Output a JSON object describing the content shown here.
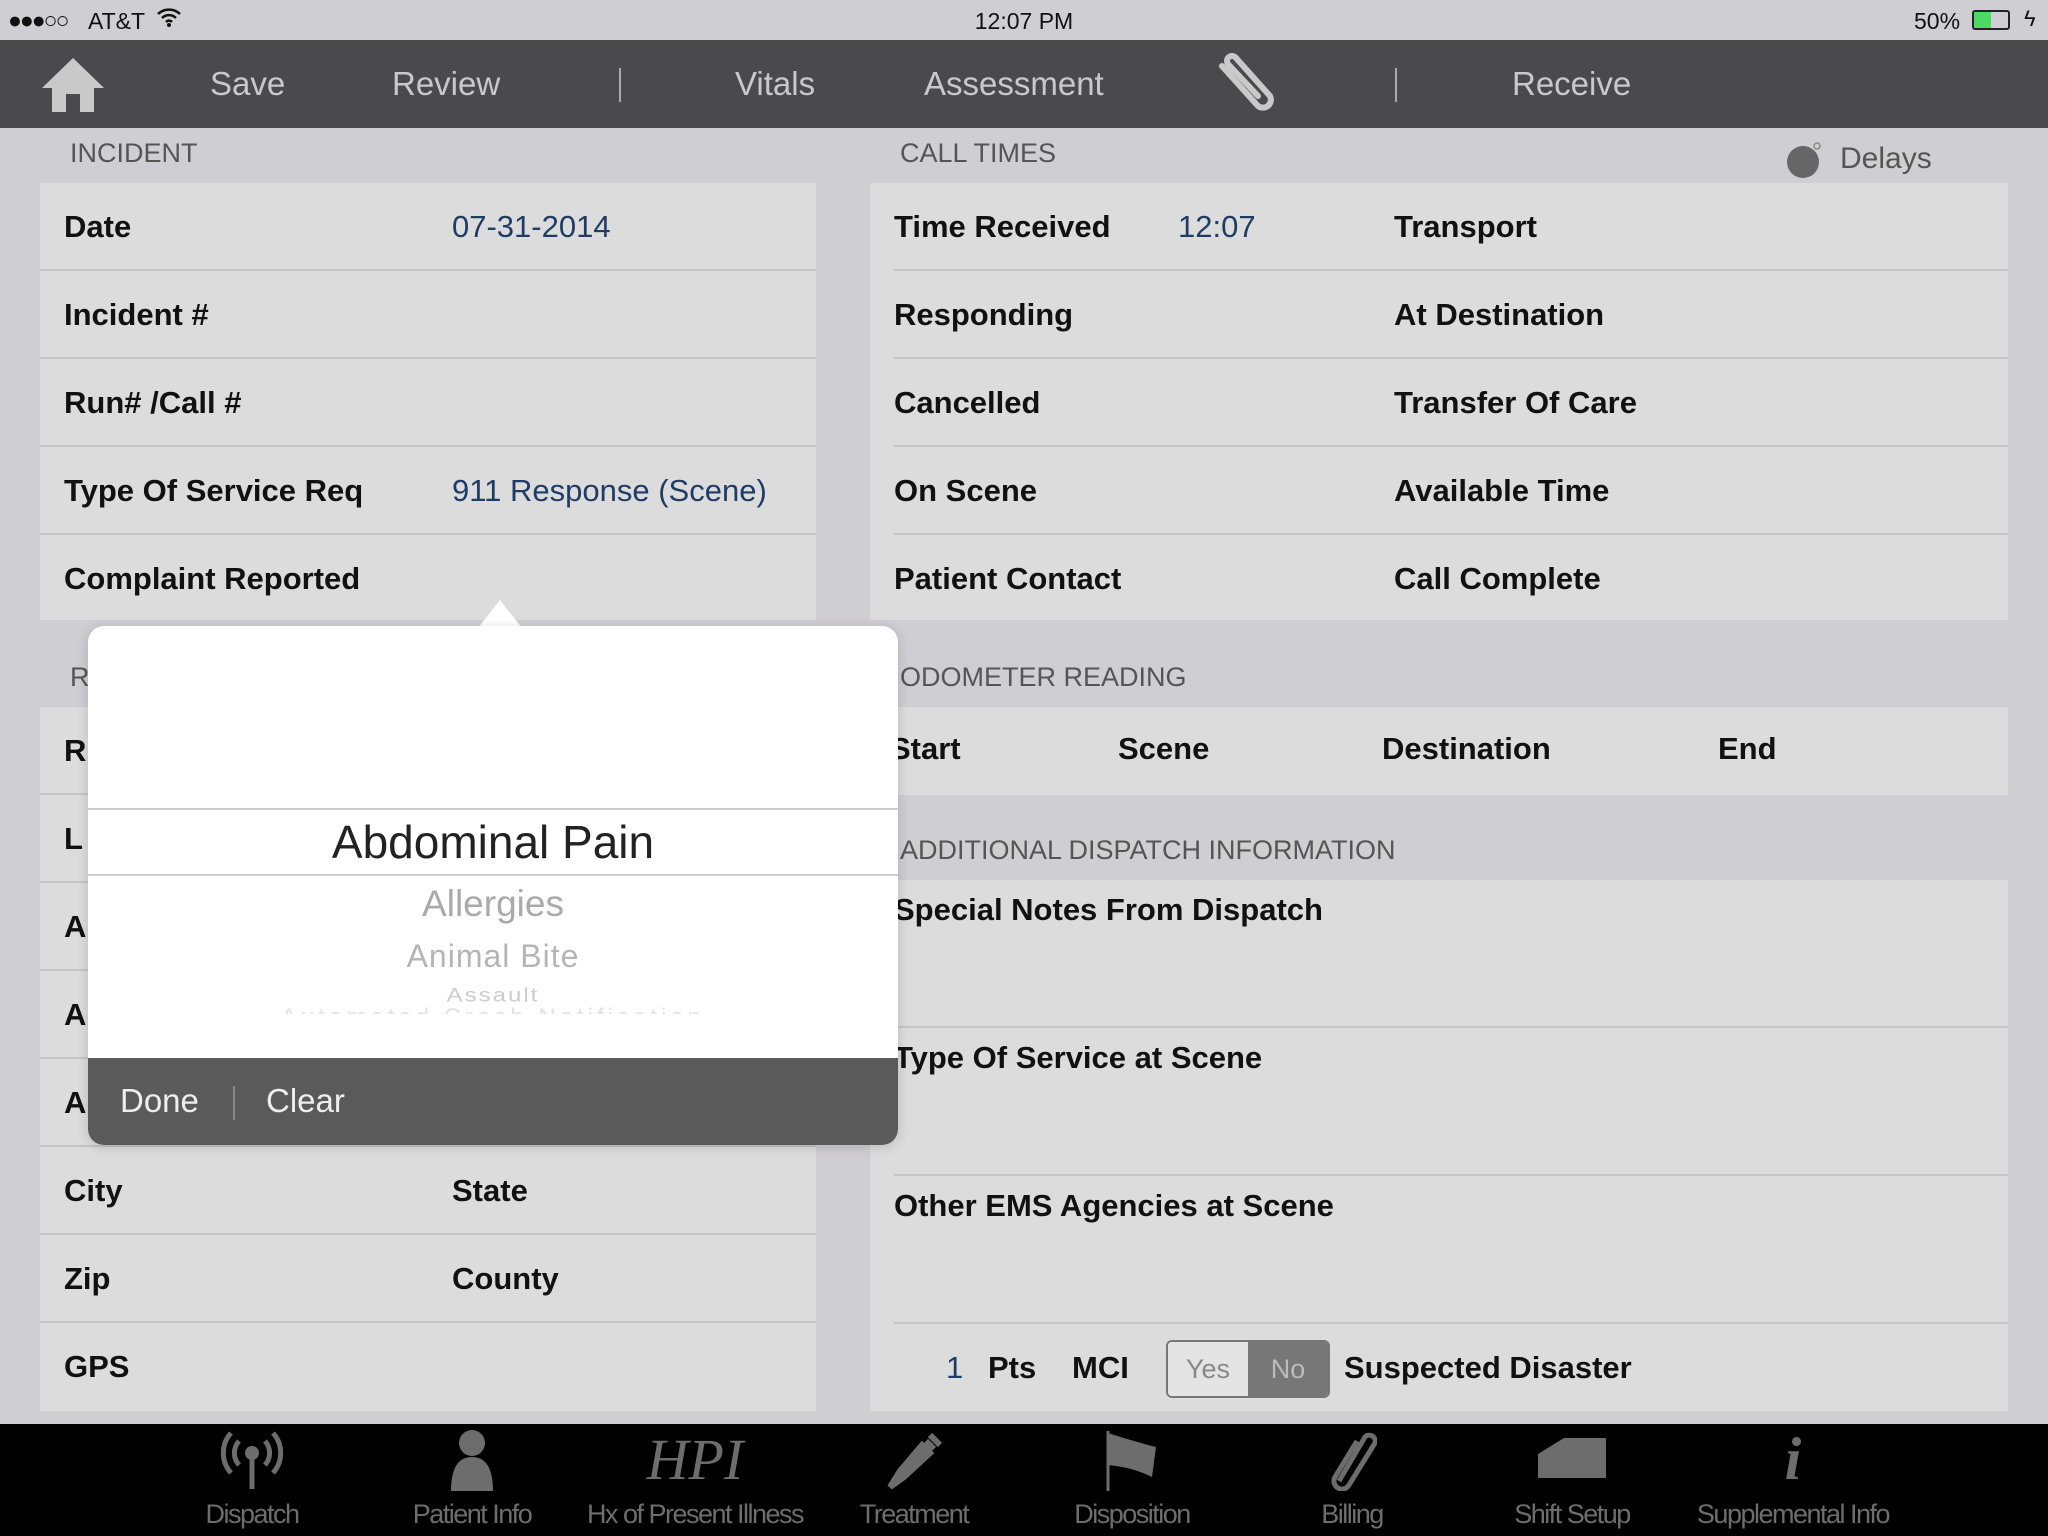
{
  "status": {
    "carrier": "AT&T",
    "time": "12:07 PM",
    "battery": "50%",
    "battery_level": 0.5,
    "battery_color": "#4cd964"
  },
  "toolbar": {
    "items": [
      "Save",
      "Review",
      "Vitals",
      "Assessment",
      "Receive"
    ],
    "icons": [
      "home-icon",
      "paperclip-icon"
    ]
  },
  "incident": {
    "header": "INCIDENT",
    "rows": [
      {
        "label": "Date",
        "value": "07-31-2014"
      },
      {
        "label": "Incident #",
        "value": ""
      },
      {
        "label": "Run# /Call #",
        "value": ""
      },
      {
        "label": "Type Of Service Req",
        "value": "911 Response (Scene)"
      },
      {
        "label": "Complaint Reported",
        "value": ""
      }
    ]
  },
  "location": {
    "header": "R",
    "rows": [
      "R",
      "L",
      "A",
      "A",
      "A"
    ],
    "pairs": [
      {
        "a": "City",
        "b": "State"
      },
      {
        "a": "Zip",
        "b": "County"
      },
      {
        "a": "GPS",
        "b": ""
      }
    ]
  },
  "call_times": {
    "header": "CALL TIMES",
    "delays": "Delays",
    "rows": [
      {
        "a": "Time Received",
        "v": "12:07",
        "b": "Transport"
      },
      {
        "a": "Responding",
        "v": "",
        "b": "At Destination"
      },
      {
        "a": "Cancelled",
        "v": "",
        "b": "Transfer Of Care"
      },
      {
        "a": "On Scene",
        "v": "",
        "b": "Available Time"
      },
      {
        "a": "Patient Contact",
        "v": "",
        "b": "Call Complete"
      }
    ]
  },
  "odometer": {
    "header": "ODOMETER READING",
    "cols": [
      "Start",
      "Scene",
      "Destination",
      "End"
    ]
  },
  "dispatch_info": {
    "header": "ADDITIONAL DISPATCH INFORMATION",
    "rows": [
      "Special Notes From Dispatch",
      "Type Of Service at Scene",
      "Other EMS Agencies at Scene"
    ],
    "pts_value": "1",
    "pts_label": "Pts",
    "mci_label": "MCI",
    "yes": "Yes",
    "no": "No",
    "mci_selected": "No",
    "suspected": "Suspected Disaster"
  },
  "picker": {
    "selected": "Abdominal Pain",
    "options": [
      "Allergies",
      "Animal Bite",
      "Assault",
      "Automated Crash Notification"
    ],
    "done": "Done",
    "clear": "Clear"
  },
  "tabs": [
    {
      "label": "Dispatch",
      "icon": "antenna-icon"
    },
    {
      "label": "Patient Info",
      "icon": "person-icon"
    },
    {
      "label": "Hx of Present Illness",
      "icon": "hpi-icon"
    },
    {
      "label": "Treatment",
      "icon": "syringe-icon"
    },
    {
      "label": "Disposition",
      "icon": "flag-icon"
    },
    {
      "label": "Billing",
      "icon": "paperclip-icon"
    },
    {
      "label": "Shift Setup",
      "icon": "ambulance-icon"
    },
    {
      "label": "Supplemental Info",
      "icon": "info-icon"
    }
  ]
}
